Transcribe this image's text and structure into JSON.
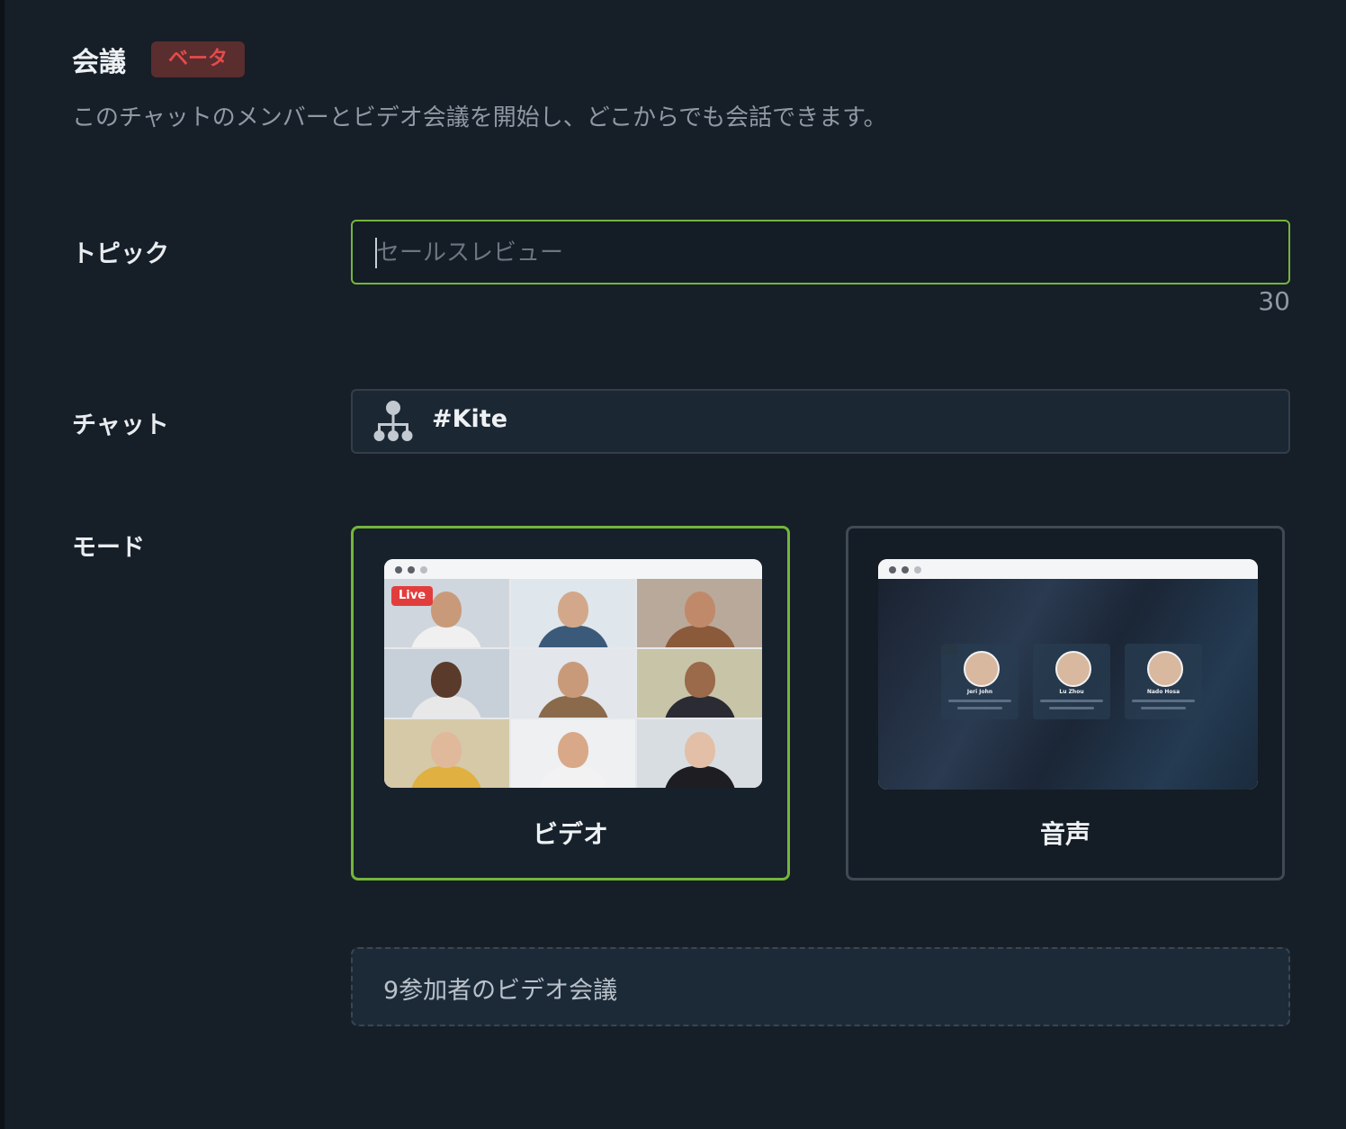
{
  "header": {
    "title": "会議",
    "badge": "ベータ",
    "subtitle": "このチャットのメンバーとビデオ会議を開始し、どこからでも会話できます。"
  },
  "form": {
    "topic": {
      "label": "トピック",
      "value": "",
      "placeholder": "セールスレビュー",
      "char_remaining": "30"
    },
    "chat": {
      "label": "チャット",
      "name": "#Kite",
      "icon": "org-chart-icon"
    },
    "mode": {
      "label": "モード",
      "selected": "video",
      "options": [
        {
          "id": "video",
          "label": "ビデオ",
          "live_badge": "Live"
        },
        {
          "id": "audio",
          "label": "音声",
          "participants": [
            {
              "name": "Jeri John"
            },
            {
              "name": "Lu Zhou"
            },
            {
              "name": "Nado Hosa"
            }
          ]
        }
      ]
    },
    "info": "9参加者のビデオ会議"
  },
  "colors": {
    "background": "#161e28",
    "accent_green": "#74b53c",
    "badge_bg": "#5a2d2f",
    "badge_text": "#e24c4c",
    "live_red": "#e23d3d"
  }
}
